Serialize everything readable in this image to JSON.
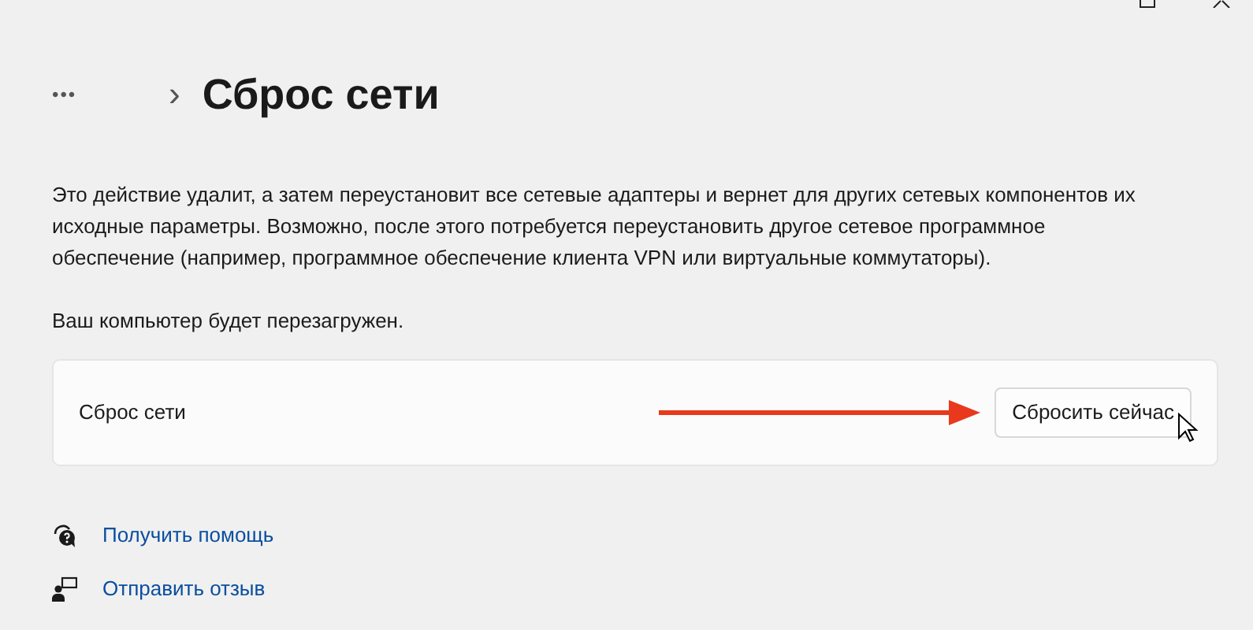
{
  "breadcrumb": {
    "more": "•••",
    "separator": "›",
    "title": "Сброс сети"
  },
  "description": "Это действие удалит, а затем переустановит все сетевые адаптеры и вернет для других сетевых компонентов их исходные параметры. Возможно, после этого потребуется переустановить другое сетевое программное обеспечение (например, программное обеспечение клиента VPN или виртуальные коммутаторы).",
  "notice": "Ваш компьютер будет перезагружен.",
  "card": {
    "label": "Сброс сети",
    "button": "Сбросить сейчас"
  },
  "links": [
    {
      "kind": "help",
      "text": "Получить помощь"
    },
    {
      "kind": "feedback",
      "text": "Отправить отзыв"
    }
  ]
}
